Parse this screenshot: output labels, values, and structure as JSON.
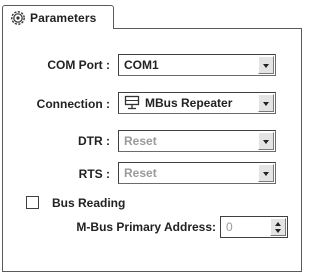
{
  "tab": {
    "label": "Parameters",
    "icon": "gear-icon"
  },
  "fields": {
    "com_port": {
      "label": "COM Port :",
      "value": "COM1"
    },
    "connection": {
      "label": "Connection :",
      "value": "MBus Repeater",
      "icon": "repeater-icon"
    },
    "dtr": {
      "label": "DTR :",
      "value": "Reset",
      "disabled": true
    },
    "rts": {
      "label": "RTS :",
      "value": "Reset",
      "disabled": true
    }
  },
  "bus_reading": {
    "label": "Bus Reading",
    "checked": false
  },
  "mbus_address": {
    "label": "M-Bus Primary Address:",
    "value": "0",
    "disabled": true
  }
}
